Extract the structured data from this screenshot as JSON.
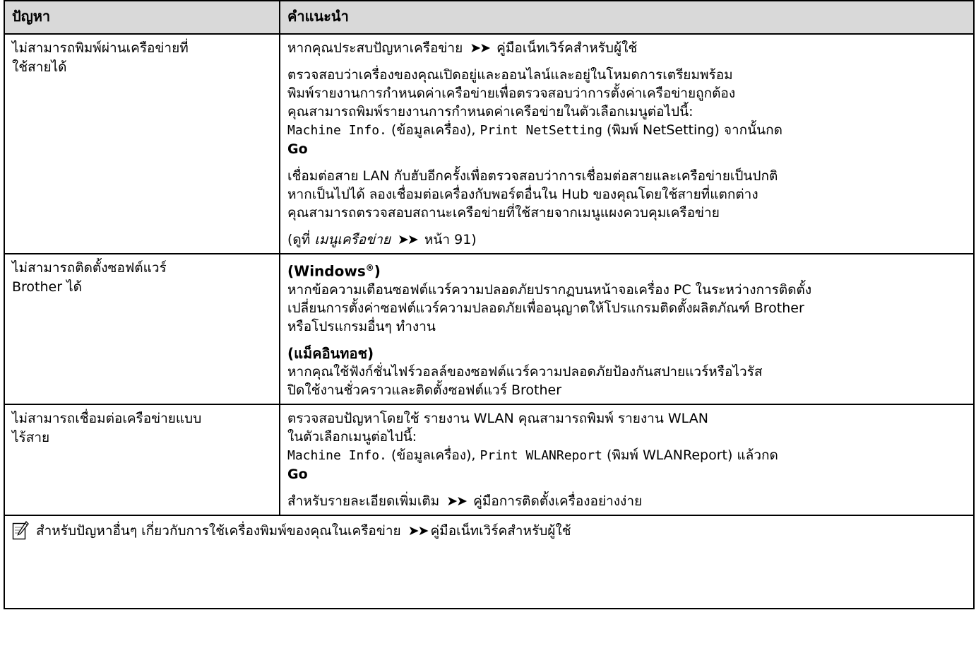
{
  "header": {
    "col1": "ปัญหา",
    "col2": "คำแนะนำ"
  },
  "rows": [
    {
      "problem_line1": "ไม่สามารถพิมพ์ผ่านเครือข่ายที่",
      "problem_line2": "ใช้สายได้",
      "p1_text": "หากคุณประสบปัญหาเครือข่าย",
      "p1_arrow": "➤➤",
      "p1_link": "คู่มือเน็ทเวิร์คสำหรับผู้ใช้",
      "p2_line1": "ตรวจสอบว่าเครื่องของคุณเปิดอยู่และออนไลน์และอยู่ในโหมดการเตรียมพร้อม",
      "p2_line2": "พิมพ์รายงานการกำหนดค่าเครือข่ายเพื่อตรวจสอบว่าการตั้งค่าเครือข่ายถูกต้อง",
      "p2_line3": "คุณสามารถพิมพ์รายงานการกำหนดค่าเครือข่ายในตัวเลือกเมนูต่อไปนี้:",
      "p2_mono1": "Machine Info.",
      "p2_text1": "(ข้อมูลเครื่อง),",
      "p2_mono2": "Print NetSetting",
      "p2_text2": "(พิมพ์ NetSetting) จากนั้นกด",
      "p2_go": "Go",
      "p3_line1": "เชื่อมต่อสาย LAN กับฮับอีกครั้งเพื่อตรวจสอบว่าการเชื่อมต่อสายและเครือข่ายเป็นปกติ",
      "p3_line2": "หากเป็นไปได้ ลองเชื่อมต่อเครื่องกับพอร์ตอื่นใน Hub ของคุณโดยใช้สายที่แตกต่าง",
      "p3_line3": "คุณสามารถตรวจสอบสถานะเครือข่ายที่ใช้สายจากเมนูแผงควบคุมเครือข่าย",
      "p4_pre": "(ดูที่",
      "p4_italic": "เมนูเครือข่าย",
      "p4_arrow": "➤➤",
      "p4_post": "หน้า 91)"
    },
    {
      "problem_line1": "ไม่สามารถติดตั้งซอฟต์แวร์",
      "problem_line2": "Brother ได้",
      "h1": "(Windows",
      "h1_sup": "®",
      "h1_close": ")",
      "b1_line1": "หากข้อความเตือนซอฟต์แวร์ความปลอดภัยปรากฏบนหน้าจอเครื่อง PC ในระหว่างการติดตั้ง",
      "b1_line2": "เปลี่ยนการตั้งค่าซอฟต์แวร์ความปลอดภัยเพื่ออนุญาตให้โปรแกรมติดตั้งผลิตภัณฑ์ Brother",
      "b1_line3": "หรือโปรแกรมอื่นๆ ทำงาน",
      "h2": "(แม็คอินทอช)",
      "b2_line1": "หากคุณใช้ฟังก์ชั่นไฟร์วอลล์ของซอฟต์แวร์ความปลอดภัยป้องกันสปายแวร์หรือไวรัส",
      "b2_line2": "ปิดใช้งานชั่วคราวและติดตั้งซอฟต์แวร์ Brother"
    },
    {
      "problem_line1": "ไม่สามารถเชื่อมต่อเครือข่ายแบบ",
      "problem_line2": "ไร้สาย",
      "p1_line1": "ตรวจสอบปัญหาโดยใช้ รายงาน WLAN คุณสามารถพิมพ์ รายงาน WLAN",
      "p1_line2": "ในตัวเลือกเมนูต่อไปนี้:",
      "p1_mono1": "Machine Info.",
      "p1_text1": "(ข้อมูลเครื่อง),",
      "p1_mono2": "Print WLANReport",
      "p1_text2": "(พิมพ์ WLANReport) แล้วกด",
      "p1_go": "Go",
      "p2_text": "สำหรับรายละเอียดเพิ่มเติม",
      "p2_arrow": "➤➤",
      "p2_link": "คู่มือการติดตั้งเครื่องอย่างง่าย"
    }
  ],
  "note": {
    "icon": "note-pencil-icon",
    "text": "สำหรับปัญหาอื่นๆ เกี่ยวกับการใช้เครื่องพิมพ์ของคุณในเครือข่าย",
    "arrow": "➤➤",
    "link": "คู่มือเน็ทเวิร์คสำหรับผู้ใช้"
  },
  "colors": {
    "header_bg": "#d9d9d9",
    "border": "#000000"
  }
}
